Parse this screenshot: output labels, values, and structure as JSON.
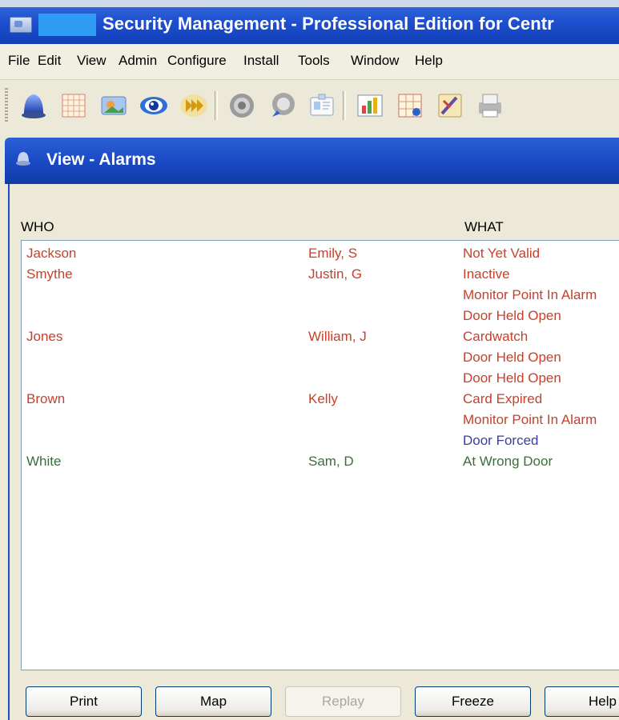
{
  "window": {
    "title": "Security Management - Professional Edition for Centr"
  },
  "menu": [
    {
      "label": "File"
    },
    {
      "label": "Edit"
    },
    {
      "label": "View"
    },
    {
      "label": "Admin"
    },
    {
      "label": "Configure"
    },
    {
      "label": "Install"
    },
    {
      "label": "Tools"
    },
    {
      "label": "Window"
    },
    {
      "label": "Help"
    }
  ],
  "toolbar": {
    "icons": [
      "alarm-bell-icon",
      "grid-icon",
      "image-icon",
      "eye-icon",
      "forward-arrows-icon",
      "gray-disc-icon",
      "spotlight-icon",
      "badge-icon",
      "bar-chart-icon",
      "user-grid-icon",
      "paint-icon",
      "printer-icon"
    ]
  },
  "alarms_window": {
    "title": "View - Alarms",
    "columns": {
      "who": "WHO",
      "what": "WHAT"
    },
    "rows": [
      {
        "last": "Jackson",
        "first": "Emily, S",
        "what": "Not Yet Valid",
        "color": "#c8402a"
      },
      {
        "last": "Smythe",
        "first": "Justin, G",
        "what": "Inactive",
        "color": "#c8402a"
      },
      {
        "last": "",
        "first": "",
        "what": "Monitor Point In Alarm",
        "color": "#c8402a"
      },
      {
        "last": "",
        "first": "",
        "what": "Door Held Open",
        "color": "#c8402a"
      },
      {
        "last": "Jones",
        "first": "William, J",
        "what": "Cardwatch",
        "color": "#c8402a"
      },
      {
        "last": "",
        "first": "",
        "what": "Door Held Open",
        "color": "#c8402a"
      },
      {
        "last": "",
        "first": "",
        "what": "Door Held Open",
        "color": "#c8402a"
      },
      {
        "last": "Brown",
        "first": "Kelly",
        "what": "Card Expired",
        "color": "#c8402a"
      },
      {
        "last": "",
        "first": "",
        "what": "Monitor Point In Alarm",
        "color": "#c8402a"
      },
      {
        "last": "",
        "first": "",
        "what": "Door Forced",
        "color": "#3b3ba6"
      },
      {
        "last": "White",
        "first": "Sam, D",
        "what": "At Wrong Door",
        "color": "#3c6e3c"
      }
    ],
    "buttons": {
      "print": "Print",
      "map": "Map",
      "replay": "Replay",
      "freeze": "Freeze",
      "help": "Help"
    }
  }
}
